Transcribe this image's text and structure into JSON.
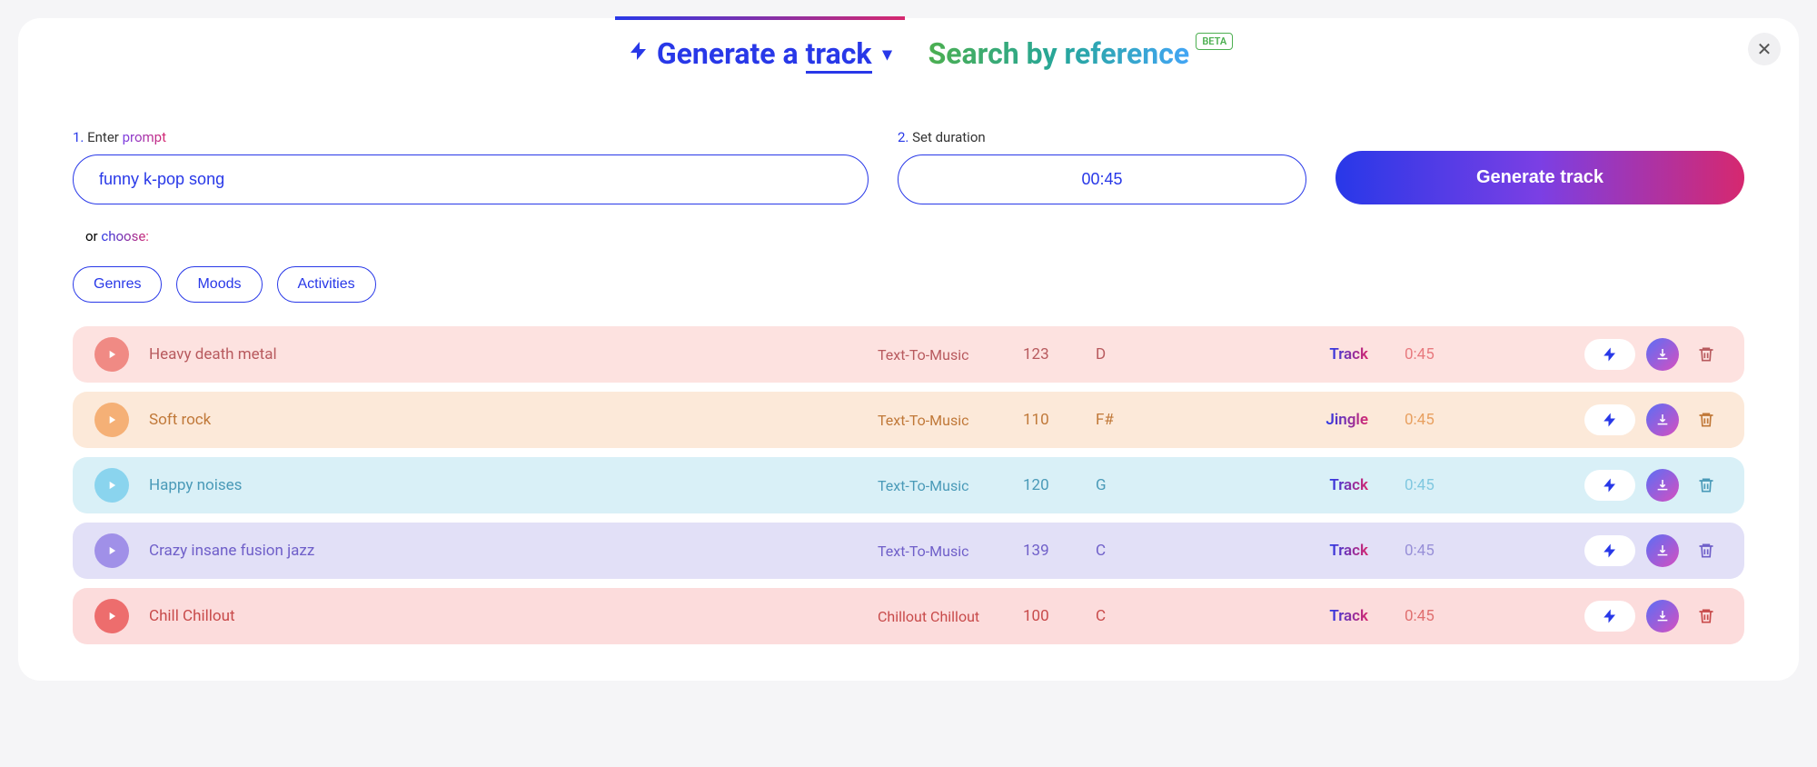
{
  "tabs": {
    "generate": "Generate a ",
    "generate_underline": "track",
    "search": "Search by reference",
    "beta": "BETA"
  },
  "form": {
    "prompt_label_prefix": "1. ",
    "prompt_label_text": "Enter ",
    "prompt_label_grad": "prompt",
    "prompt_value": "funny k-pop song",
    "duration_label_prefix": "2. ",
    "duration_label_text": "Set duration",
    "duration_value": "00:45",
    "generate_button": "Generate track"
  },
  "or_choose_prefix": "or ",
  "or_choose_grad": "choose:",
  "chips": [
    "Genres",
    "Moods",
    "Activities"
  ],
  "tracks": [
    {
      "title": "Heavy death metal",
      "tags": "Text-To-Music",
      "bpm": "123",
      "key": "D",
      "kind": "Track",
      "duration": "0:45"
    },
    {
      "title": "Soft rock",
      "tags": "Text-To-Music",
      "bpm": "110",
      "key": "F#",
      "kind": "Jingle",
      "duration": "0:45"
    },
    {
      "title": "Happy noises",
      "tags": "Text-To-Music",
      "bpm": "120",
      "key": "G",
      "kind": "Track",
      "duration": "0:45"
    },
    {
      "title": "Crazy insane fusion jazz",
      "tags": "Text-To-Music",
      "bpm": "139",
      "key": "C",
      "kind": "Track",
      "duration": "0:45"
    },
    {
      "title": "Chill Chillout",
      "tags": "Chillout     Chillout",
      "bpm": "100",
      "key": "C",
      "kind": "Track",
      "duration": "0:45"
    }
  ]
}
